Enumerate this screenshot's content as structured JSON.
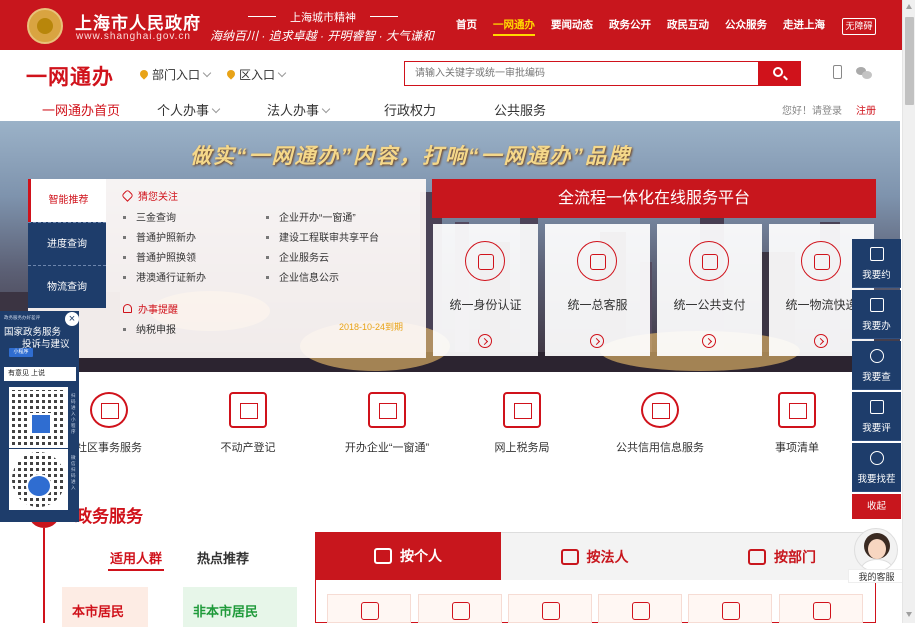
{
  "header": {
    "title": "上海市人民政府",
    "url": "www.shanghai.gov.cn",
    "spirit_title": "上海城市精神",
    "spirit_text": "海纳百川 · 追求卓越 · 开明睿智 · 大气谦和",
    "nav": [
      {
        "label": "首页"
      },
      {
        "label": "一网通办"
      },
      {
        "label": "要闻动态"
      },
      {
        "label": "政务公开"
      },
      {
        "label": "政民互动"
      },
      {
        "label": "公众服务"
      },
      {
        "label": "走进上海"
      }
    ],
    "accessible_label": "无障碍"
  },
  "brand": {
    "name": "一网通办",
    "dept_entry": "部门入口",
    "district_entry": "区入口",
    "search_placeholder": "请输入关键字或统一审批编码"
  },
  "subnav": {
    "items": [
      {
        "label": "一网通办首页"
      },
      {
        "label": "个人办事"
      },
      {
        "label": "法人办事"
      },
      {
        "label": "行政权力"
      },
      {
        "label": "公共服务"
      }
    ],
    "greeting": "您好！请登录",
    "register": "注册"
  },
  "banner": {
    "slogan": "做实“一网通办”内容，打响“一网通办”品牌",
    "platform_title": "全流程一体化在线服务平台",
    "tabs": [
      {
        "label": "智能推荐"
      },
      {
        "label": "进度查询"
      },
      {
        "label": "物流查询"
      }
    ],
    "focus_title": "猜您关注",
    "focus_items": [
      {
        "label": "三金查询"
      },
      {
        "label": "企业开办“一窗通”"
      },
      {
        "label": "普通护照新办"
      },
      {
        "label": "建设工程联审共享平台"
      },
      {
        "label": "普通护照换领"
      },
      {
        "label": "企业服务云"
      },
      {
        "label": "港澳通行证新办"
      },
      {
        "label": "企业信息公示"
      }
    ],
    "remind_title": "办事提醒",
    "remind_item": "纳税申报",
    "remind_date": "2018-10-24到期",
    "cards": [
      {
        "label": "统一身份认证"
      },
      {
        "label": "统一总客服"
      },
      {
        "label": "统一公共支付"
      },
      {
        "label": "统一物流快递"
      }
    ]
  },
  "right_float": [
    {
      "label": "我要约"
    },
    {
      "label": "我要办"
    },
    {
      "label": "我要查"
    },
    {
      "label": "我要评"
    },
    {
      "label": "我要找茬"
    }
  ],
  "collapse_label": "收起",
  "services": [
    {
      "label": "社区事务服务"
    },
    {
      "label": "不动产登记"
    },
    {
      "label": "开办企业“一窗通”"
    },
    {
      "label": "网上税务局"
    },
    {
      "label": "公共信用信息服务"
    },
    {
      "label": "事项清单"
    }
  ],
  "gov_services": {
    "title": "政务服务",
    "aud_tabs": [
      {
        "label": "适用人群"
      },
      {
        "label": "热点推荐"
      }
    ],
    "res_cards": [
      {
        "label": "本市居民"
      },
      {
        "label": "非本市居民"
      }
    ],
    "cat_tabs": [
      {
        "label": "按个人"
      },
      {
        "label": "按法人"
      },
      {
        "label": "按部门"
      }
    ]
  },
  "mini_program": {
    "header": "政务服务办好差评",
    "title1": "国家政务服务",
    "title2": "投诉与建议",
    "badge": "小程序",
    "strip": "有意见 上说",
    "side1": "扫码进入小程序",
    "side2": "微信扫码进入"
  },
  "customer_service": {
    "label": "我的客服"
  },
  "colors": {
    "red": "#c8161d",
    "navy": "#1e3d6b",
    "gold": "#ffd800"
  }
}
